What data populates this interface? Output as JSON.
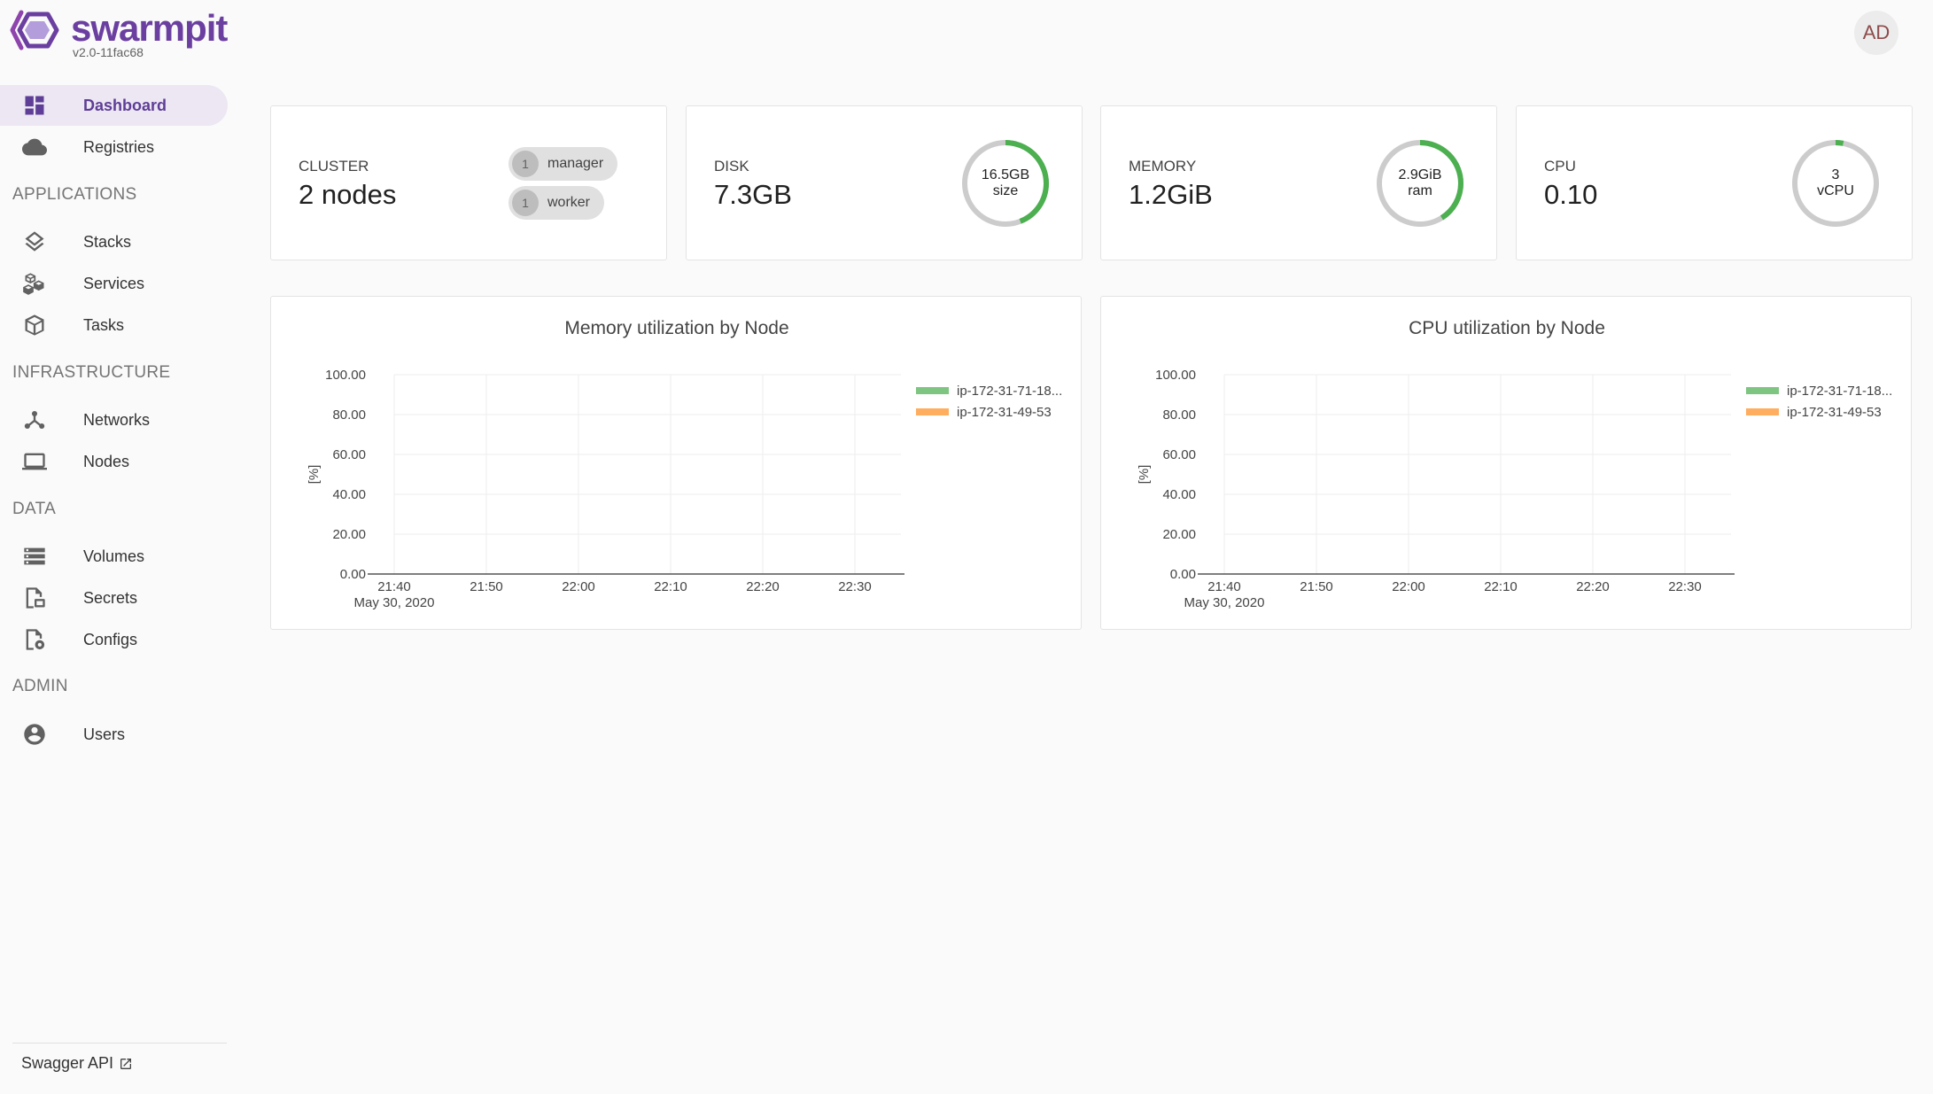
{
  "app": {
    "name": "swarmpit",
    "version": "v2.0-11fac68"
  },
  "user": {
    "initials": "AD"
  },
  "sidebar": {
    "top_items": [
      {
        "label": "Dashboard",
        "icon": "dashboard-icon",
        "active": true
      },
      {
        "label": "Registries",
        "icon": "cloud-icon",
        "active": false
      }
    ],
    "sections": [
      {
        "title": "APPLICATIONS",
        "items": [
          {
            "label": "Stacks",
            "icon": "layers-icon"
          },
          {
            "label": "Services",
            "icon": "cubes-icon"
          },
          {
            "label": "Tasks",
            "icon": "cube-icon"
          }
        ]
      },
      {
        "title": "INFRASTRUCTURE",
        "items": [
          {
            "label": "Networks",
            "icon": "network-icon"
          },
          {
            "label": "Nodes",
            "icon": "laptop-icon"
          }
        ]
      },
      {
        "title": "DATA",
        "items": [
          {
            "label": "Volumes",
            "icon": "storage-icon"
          },
          {
            "label": "Secrets",
            "icon": "secret-file-icon"
          },
          {
            "label": "Configs",
            "icon": "config-file-icon"
          }
        ]
      },
      {
        "title": "ADMIN",
        "items": [
          {
            "label": "Users",
            "icon": "account-circle-icon"
          }
        ]
      }
    ],
    "footer_link": "Swagger API"
  },
  "stats": {
    "cluster": {
      "title": "CLUSTER",
      "value": "2 nodes",
      "chips": [
        {
          "count": "1",
          "label": "manager"
        },
        {
          "count": "1",
          "label": "worker"
        }
      ]
    },
    "disk": {
      "title": "DISK",
      "value": "7.3GB",
      "gauge_line1": "16.5GB",
      "gauge_line2": "size",
      "fraction": 0.44
    },
    "memory": {
      "title": "MEMORY",
      "value": "1.2GiB",
      "gauge_line1": "2.9GiB",
      "gauge_line2": "ram",
      "fraction": 0.41
    },
    "cpu": {
      "title": "CPU",
      "value": "0.10",
      "gauge_line1": "3",
      "gauge_line2": "vCPU",
      "fraction": 0.03
    }
  },
  "colors": {
    "accent": "#5e3e96",
    "gauge_fill": "#4caf50",
    "gauge_track": "#cccccc",
    "series_1": "#66bb6a",
    "series_2": "#ff9f43"
  },
  "chart_data": [
    {
      "type": "line",
      "title": "Memory utilization by Node",
      "ylabel": "[%]",
      "xlabel": "",
      "ylim": [
        0,
        100
      ],
      "yticks": [
        "100.00",
        "80.00",
        "60.00",
        "40.00",
        "20.00",
        "0.00"
      ],
      "xticks": [
        "21:40",
        "21:50",
        "22:00",
        "22:10",
        "22:20",
        "22:30"
      ],
      "x_date_label": "May 30, 2020",
      "legend_position": "top-right",
      "series": [
        {
          "name": "ip-172-31-71-18...",
          "values": []
        },
        {
          "name": "ip-172-31-49-53",
          "values": []
        }
      ]
    },
    {
      "type": "line",
      "title": "CPU utilization by Node",
      "ylabel": "[%]",
      "xlabel": "",
      "ylim": [
        0,
        100
      ],
      "yticks": [
        "100.00",
        "80.00",
        "60.00",
        "40.00",
        "20.00",
        "0.00"
      ],
      "xticks": [
        "21:40",
        "21:50",
        "22:00",
        "22:10",
        "22:20",
        "22:30"
      ],
      "x_date_label": "May 30, 2020",
      "legend_position": "top-right",
      "series": [
        {
          "name": "ip-172-31-71-18...",
          "values": []
        },
        {
          "name": "ip-172-31-49-53",
          "values": []
        }
      ]
    }
  ]
}
